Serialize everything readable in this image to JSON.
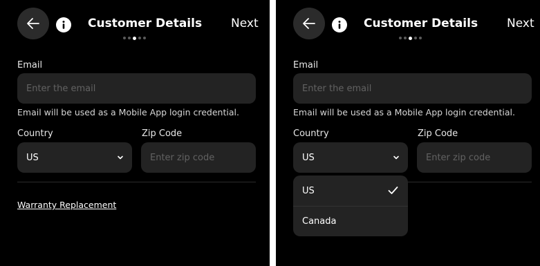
{
  "header": {
    "title": "Customer Details",
    "next_label": "Next",
    "step_count": 5,
    "active_step": 3
  },
  "form": {
    "email_label": "Email",
    "email_placeholder": "Enter the email",
    "email_helper": "Email will be used as a Mobile App login credential.",
    "country_label": "Country",
    "country_value": "US",
    "zip_label": "Zip Code",
    "zip_placeholder": "Enter zip code",
    "warranty_link": "Warranty Replacement"
  },
  "dropdown": {
    "options": [
      "US",
      "Canada"
    ],
    "selected": "US"
  },
  "icons": {
    "back": "arrow-left-icon",
    "info": "info-icon",
    "chevron": "chevron-down-icon",
    "check": "checkmark-icon"
  }
}
